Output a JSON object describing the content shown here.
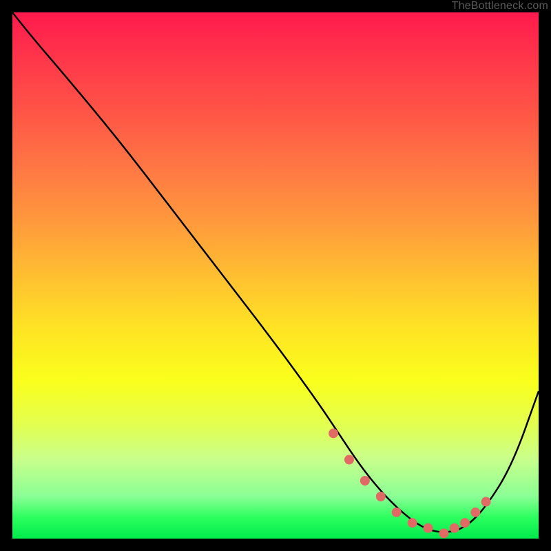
{
  "watermark": "TheBottleneck.com",
  "chart_data": {
    "type": "line",
    "title": "",
    "xlabel": "",
    "ylabel": "",
    "xlim": [
      0,
      100
    ],
    "ylim": [
      0,
      100
    ],
    "grid": false,
    "series": [
      {
        "name": "curve",
        "x": [
          0,
          4,
          10,
          20,
          30,
          40,
          50,
          58,
          62,
          66,
          70,
          74,
          78,
          82,
          86,
          90,
          95,
          100
        ],
        "y": [
          100,
          95,
          88,
          76,
          63,
          50,
          37,
          26,
          20,
          14,
          9,
          5,
          2,
          1,
          2,
          6,
          14,
          28
        ],
        "color": "#000000"
      }
    ],
    "markers": {
      "name": "highlight-dots",
      "x": [
        61,
        64,
        67,
        70,
        73,
        76,
        79,
        82,
        84,
        86,
        88,
        90
      ],
      "y": [
        20,
        15,
        11,
        8,
        5,
        3,
        2,
        1,
        2,
        3,
        5,
        7
      ],
      "color": "#e16a65"
    }
  }
}
